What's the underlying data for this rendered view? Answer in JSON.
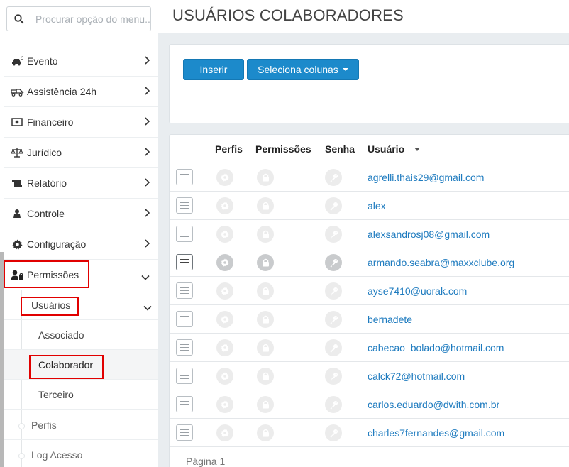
{
  "search": {
    "placeholder": "Procurar opção do menu..."
  },
  "sidebar": {
    "items": [
      {
        "label": "Evento",
        "icon": "car-crash-icon"
      },
      {
        "label": "Assistência 24h",
        "icon": "tow-truck-icon"
      },
      {
        "label": "Financeiro",
        "icon": "money-icon"
      },
      {
        "label": "Jurídico",
        "icon": "balance-scale-icon"
      },
      {
        "label": "Relatório",
        "icon": "scroll-icon"
      },
      {
        "label": "Controle",
        "icon": "person-icon"
      },
      {
        "label": "Configuração",
        "icon": "gear-icon"
      },
      {
        "label": "Permissões",
        "icon": "user-lock-icon"
      }
    ],
    "sub": {
      "usuarios": "Usuários",
      "associado": "Associado",
      "colaborador": "Colaborador",
      "terceiro": "Terceiro",
      "perfis": "Perfis",
      "log_acesso": "Log Acesso"
    }
  },
  "page": {
    "title": "USUÁRIOS COLABORADORES"
  },
  "toolbar": {
    "insert_label": "Inserir",
    "columns_label": "Seleciona colunas"
  },
  "table": {
    "headers": {
      "perfis": "Perfis",
      "permissoes": "Permissões",
      "senha": "Senha",
      "usuario": "Usuário"
    },
    "rows": [
      "agrelli.thais29@gmail.com",
      "alex",
      "alexsandrosj08@gmail.com",
      "armando.seabra@maxxclube.org",
      "ayse7410@uorak.com",
      "bernadete",
      "cabecao_bolado@hotmail.com",
      "calck72@hotmail.com",
      "carlos.eduardo@dwith.com.br",
      "charles7fernandes@gmail.com"
    ],
    "pager": "Página 1"
  },
  "colors": {
    "primary": "#1c8acb",
    "link": "#1e7bbf",
    "highlight": "#e10000"
  }
}
